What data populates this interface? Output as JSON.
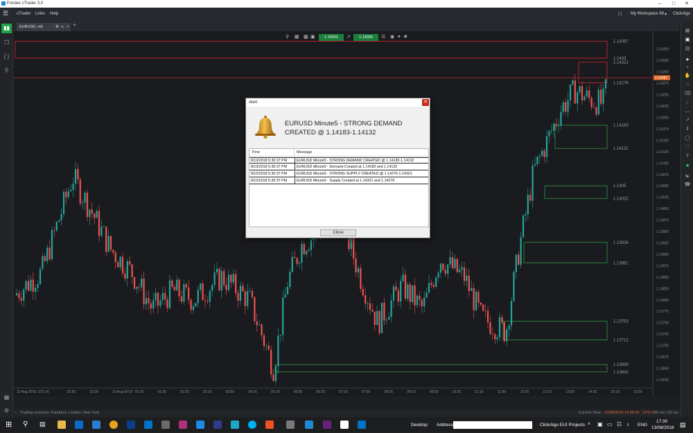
{
  "window": {
    "title": "Fondex cTrader 3.0"
  },
  "menu": {
    "app": "cTrader",
    "links": "Links",
    "help": "Help",
    "workspace": "My Workspace 68",
    "user": "ClickAlgo"
  },
  "tab": {
    "label": "EURUSD, m5"
  },
  "toolbar": {
    "price_a": "1.14201",
    "price_b": "1.14306"
  },
  "chart_data": {
    "type": "candlestick",
    "symbol": "EURUSD",
    "timeframe": "m5",
    "ylim": [
      1.1359,
      1.1438
    ],
    "price_ticks": [
      "1.14350",
      "1.14325",
      "1.14300",
      "1.14275",
      "1.14250",
      "1.14225",
      "1.14200",
      "1.14175",
      "1.14150",
      "1.14125",
      "1.14100",
      "1.14075",
      "1.14050",
      "1.14025",
      "1.14000",
      "1.13975",
      "1.13950",
      "1.13925",
      "1.13900",
      "1.13875",
      "1.13850",
      "1.13825",
      "1.13800",
      "1.13775",
      "1.13750",
      "1.13725",
      "1.13700",
      "1.13675",
      "1.13650",
      "1.13625"
    ],
    "current_price": "1.14287",
    "time_labels": [
      "12 Aug 2018, UTC+0",
      "22:50",
      "23:30",
      "13 Aug 00:10",
      "01:10",
      "01:50",
      "02:30",
      "03:10",
      "03:50",
      "04:30",
      "05:10",
      "05:50",
      "06:30",
      "07:10",
      "07:50",
      "08:30",
      "09:10",
      "09:50",
      "10:30",
      "11:10",
      "11:50",
      "12:30",
      "13:10",
      "13:50",
      "14:30",
      "15:10",
      "15:50"
    ],
    "zone_labels": [
      "1.14367",
      "1.1433",
      "1.14321",
      "1.14276",
      "1.14183",
      "1.14132",
      "1.1405",
      "1.14022",
      "1.13926",
      "1.13881",
      "1.13753",
      "1.13712",
      "1.13658",
      "1.13642"
    ],
    "zones": [
      {
        "kind": "supply",
        "top": 1.14367,
        "bottom": 1.1433
      },
      {
        "kind": "supply",
        "top": 1.14321,
        "bottom": 1.14276
      },
      {
        "kind": "demand",
        "top": 1.14183,
        "bottom": 1.14132
      },
      {
        "kind": "demand",
        "top": 1.1405,
        "bottom": 1.14022
      },
      {
        "kind": "demand",
        "top": 1.13926,
        "bottom": 1.13881
      },
      {
        "kind": "demand",
        "top": 1.13753,
        "bottom": 1.13712
      },
      {
        "kind": "demand",
        "top": 1.13658,
        "bottom": 1.13642
      }
    ]
  },
  "alert": {
    "title": "Alert",
    "heading": "EURUSD Minute5 - STRONG DEMAND CREATED @ 1.14183-1.14132",
    "col_time": "Time",
    "col_message": "Message",
    "rows": [
      {
        "time": "8/13/2018 5:30:37 PM",
        "message": "EURUSD Minute5 - STRONG DEMAND CREATED @ 1.14183-1.14132"
      },
      {
        "time": "8/13/2018 5:30:37 PM",
        "message": "EURUSD Minute5 - Demand Created at 1.14183 and 1.14132"
      },
      {
        "time": "8/13/2018 5:30:37 PM",
        "message": "EURUSD Minute5 - STRONG SUPPLY CREATED @ 1.14276-1.14321"
      },
      {
        "time": "8/13/2018 5:30:37 PM",
        "message": "EURUSD Minute5 - Supply Created at 1.14321 and 1.14276"
      }
    ],
    "close_label": "Close"
  },
  "status": {
    "sessions": "Trading sessions:  Frankfurt, London, New York",
    "current_time_label": "Current Time:",
    "current_time": "13/08/2018 14:30:43",
    "tz": "UTC+0",
    "latency": "35 ms / 55 ms"
  },
  "taskbar": {
    "desktop": "Desktop",
    "address": "Address",
    "projects": "ClickAlgo EUI Projects",
    "lang": "ENG",
    "time": "17:30",
    "date": "13/08/2018"
  },
  "colors": {
    "bull": "#26a69a",
    "bear": "#ef5350",
    "supply": "#c0262d",
    "demand": "#2e8b3a",
    "accent": "#1fa34a"
  }
}
